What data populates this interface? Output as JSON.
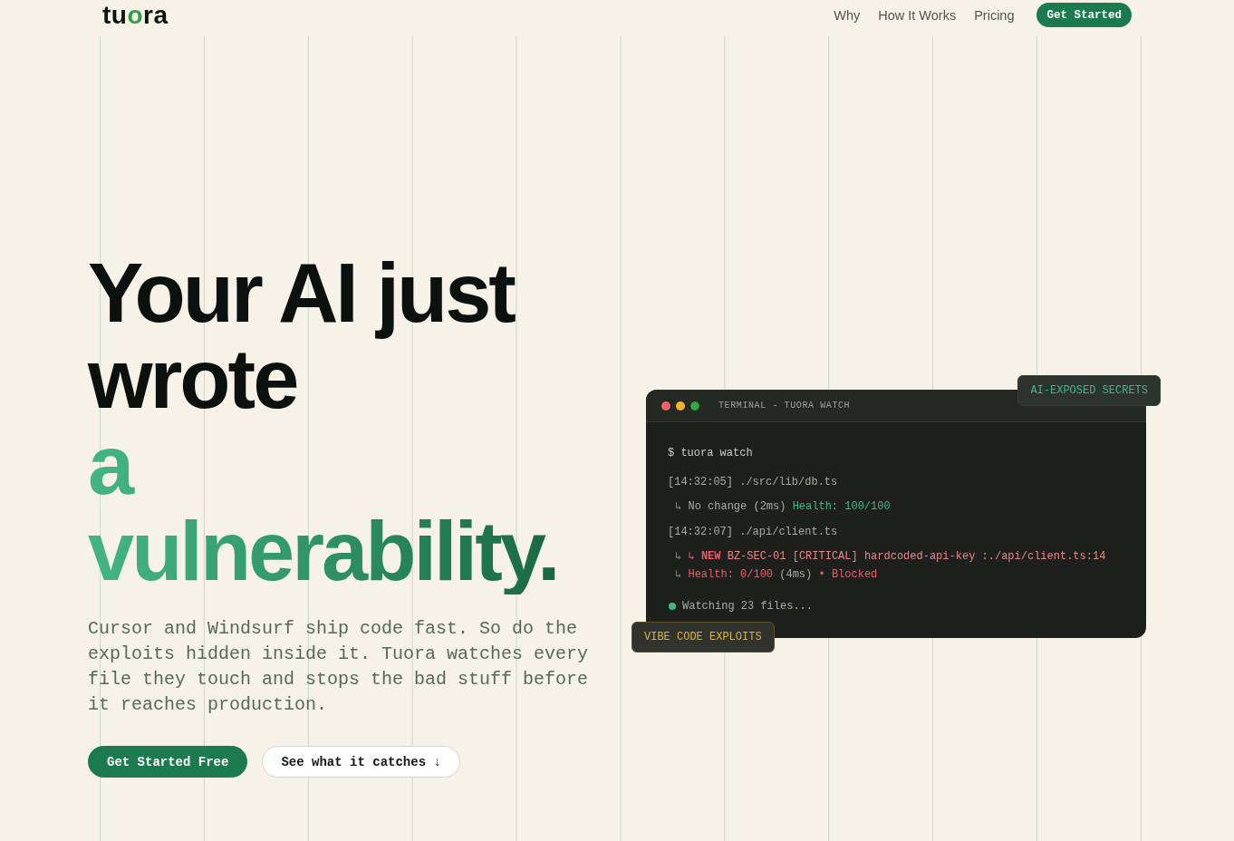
{
  "header": {
    "logo": [
      {
        "text": "tu",
        "kind": "plain"
      },
      {
        "text": "o",
        "kind": "accent"
      },
      {
        "text": "ra",
        "kind": "plain"
      }
    ],
    "nav": [
      "Why",
      "How It Works",
      "Pricing"
    ],
    "cta": "Get Started"
  },
  "hero": {
    "headline": "Your AI just wrote **a vulnerability.**",
    "description": "Cursor and Windsurf ship code fast. So do the exploits hidden inside it. Tuora watches every file they touch and stops the bad stuff before it reaches production.",
    "buttons": [
      {
        "label": "Get Started Free",
        "kind": "primary"
      },
      {
        "label": "See what it catches ↓",
        "kind": "secondary"
      }
    ]
  },
  "terminal": {
    "title": "TERMINAL - TUORA WATCH",
    "lines": [
      {
        "kind": "command",
        "segments": [
          {
            "text": "$ tuora watch",
            "kind": "command"
          }
        ]
      },
      {
        "kind": "file",
        "segments": [
          {
            "text": "[14:32:05] ./src/lib/db.ts",
            "kind": "text"
          }
        ]
      },
      {
        "kind": "detail",
        "segments": [
          {
            "text": "↳ ",
            "kind": "dim"
          },
          {
            "text": "No change (2ms) ",
            "kind": "text"
          },
          {
            "text": "Health: 100/100",
            "kind": "ok"
          }
        ]
      },
      {
        "kind": "file",
        "segments": [
          {
            "text": "[14:32:07] ./api/client.ts",
            "kind": "text"
          }
        ]
      },
      {
        "kind": "detail",
        "segments": [
          {
            "text": "↳ ",
            "kind": "dim"
          },
          {
            "text": "↳ ",
            "kind": "alert"
          },
          {
            "text": "NEW",
            "kind": "alert_strong"
          },
          {
            "text": " BZ-SEC-01 [CRITICAL] hardcoded-api-key :./api/client.ts:14",
            "kind": "alert_soft"
          }
        ]
      },
      {
        "kind": "detail",
        "segments": [
          {
            "text": "↳ ",
            "kind": "dim"
          },
          {
            "text": "Health: 0/100",
            "kind": "alert"
          },
          {
            "text": " (4ms) ",
            "kind": "text"
          },
          {
            "text": "• Blocked",
            "kind": "alert"
          }
        ]
      },
      {
        "kind": "status",
        "segments": [
          {
            "text": "Watching 23 files...",
            "kind": "text"
          }
        ]
      }
    ],
    "badges": [
      {
        "text": "AI-EXPOSED SECRETS",
        "kind": "success"
      },
      {
        "text": "VIBE CODE EXPLOITS",
        "kind": "warning"
      }
    ]
  }
}
